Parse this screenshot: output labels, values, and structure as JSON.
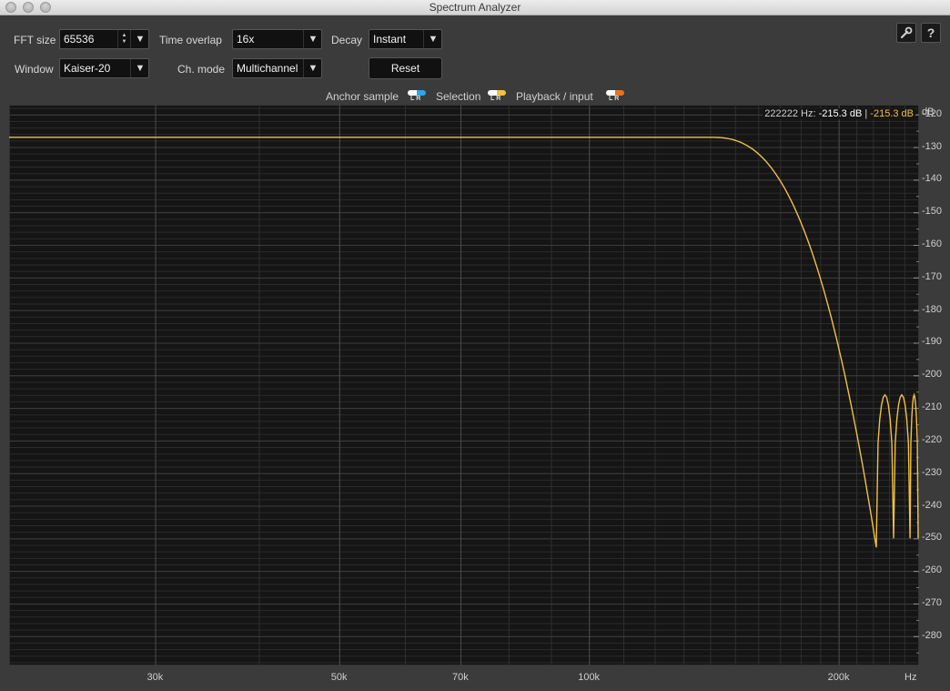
{
  "window": {
    "title": "Spectrum Analyzer"
  },
  "controls": {
    "fft_size": {
      "label": "FFT size",
      "value": "65536"
    },
    "time_overlap": {
      "label": "Time overlap",
      "value": "16x"
    },
    "decay": {
      "label": "Decay",
      "value": "Instant"
    },
    "window": {
      "label": "Window",
      "value": "Kaiser-20"
    },
    "ch_mode": {
      "label": "Ch. mode",
      "value": "Multichannel"
    },
    "reset_label": "Reset"
  },
  "legend": {
    "anchor": {
      "label": "Anchor sample",
      "colors": [
        "#ffffff",
        "#2aa7e8"
      ]
    },
    "selection": {
      "label": "Selection",
      "colors": [
        "#ffffff",
        "#f3c041"
      ]
    },
    "playback": {
      "label": "Playback / input",
      "colors": [
        "#ffffff",
        "#e8731f"
      ]
    },
    "lr": "LR"
  },
  "readout": {
    "freq": "222222 Hz:",
    "value_l": "-215.3 dB",
    "sep": "|",
    "value_r": "-215.3 dB"
  },
  "colors": {
    "trace": "#f3c041",
    "plot_bg": "#151515",
    "grid": "#3a3a3a"
  },
  "chart_data": {
    "type": "line",
    "xscale": "log",
    "xlim": [
      20000,
      250000
    ],
    "ylim": [
      -289,
      -117
    ],
    "x_unit": "Hz",
    "y_unit": "dB",
    "x_ticks": [
      {
        "v": 30000,
        "label": "30k"
      },
      {
        "v": 50000,
        "label": "50k"
      },
      {
        "v": 70000,
        "label": "70k"
      },
      {
        "v": 100000,
        "label": "100k"
      },
      {
        "v": 200000,
        "label": "200k"
      }
    ],
    "y_ticks": [
      -120,
      -130,
      -140,
      -150,
      -160,
      -170,
      -180,
      -190,
      -200,
      -210,
      -220,
      -230,
      -240,
      -250,
      -260,
      -270,
      -280
    ],
    "series": [
      {
        "passband_level_db": -127,
        "rolloff_start_hz": 140000,
        "cutoff_hz": 222000,
        "sidelobe_peak_db": -206,
        "sidelobe_floor_db": -250
      }
    ]
  }
}
